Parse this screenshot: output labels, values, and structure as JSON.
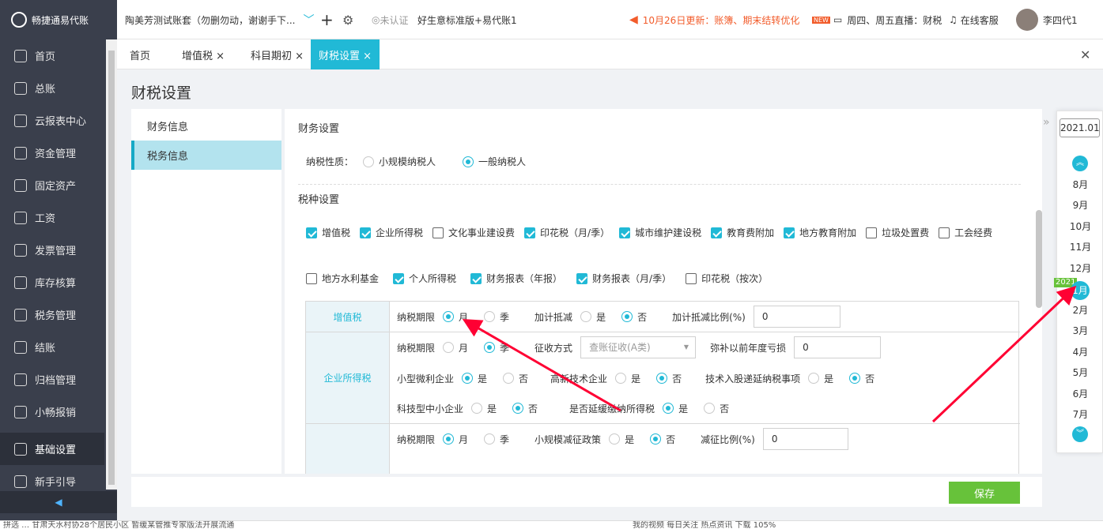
{
  "topbar": {
    "logo": "畅捷通易代账",
    "account": "陶美芳测试账套（勿删勿动，谢谢手下...",
    "plus": "+",
    "cert": "未认证",
    "product": "好生意标准版+易代账1",
    "notice": "10月26日更新：账簿、期末结转优化",
    "live_badge": "NEW",
    "live": "周四、周五直播：财税",
    "service": "在线客服",
    "user": "李四代1"
  },
  "sidebar": {
    "items": [
      {
        "label": "首页",
        "icon": "home-icon"
      },
      {
        "label": "总账",
        "icon": "ledger-icon"
      },
      {
        "label": "云报表中心",
        "icon": "chart-icon"
      },
      {
        "label": "资金管理",
        "icon": "money-icon"
      },
      {
        "label": "固定资产",
        "icon": "asset-icon"
      },
      {
        "label": "工资",
        "icon": "salary-icon"
      },
      {
        "label": "发票管理",
        "icon": "invoice-icon"
      },
      {
        "label": "库存核算",
        "icon": "warehouse-icon"
      },
      {
        "label": "税务管理",
        "icon": "tax-icon"
      },
      {
        "label": "结账",
        "icon": "close-book-icon"
      },
      {
        "label": "归档管理",
        "icon": "archive-icon"
      },
      {
        "label": "小畅报销",
        "icon": "reimburse-icon"
      },
      {
        "label": "基础设置",
        "icon": "settings-icon"
      },
      {
        "label": "新手引导",
        "icon": "guide-icon"
      }
    ]
  },
  "tabs": [
    {
      "label": "首页"
    },
    {
      "label": "增值税 ×"
    },
    {
      "label": "科目期初 ×"
    },
    {
      "label": "财税设置 ×"
    }
  ],
  "page": {
    "title": "财税设置",
    "left_nav": [
      "财务信息",
      "税务信息"
    ]
  },
  "panel": {
    "section1": "财务设置",
    "nature_label": "纳税性质：",
    "nature_options": [
      {
        "label": "小规模纳税人",
        "selected": false
      },
      {
        "label": "一般纳税人",
        "selected": true
      }
    ],
    "section2": "税种设置",
    "taxes_row1": [
      {
        "label": "增值税",
        "checked": true
      },
      {
        "label": "企业所得税",
        "checked": true
      },
      {
        "label": "文化事业建设费",
        "checked": false
      },
      {
        "label": "印花税（月/季）",
        "checked": true
      },
      {
        "label": "城市维护建设税",
        "checked": true
      },
      {
        "label": "教育费附加",
        "checked": true
      },
      {
        "label": "地方教育附加",
        "checked": true
      },
      {
        "label": "垃圾处置费",
        "checked": false
      },
      {
        "label": "工会经费",
        "checked": false
      }
    ],
    "taxes_row2": [
      {
        "label": "地方水利基金",
        "checked": false
      },
      {
        "label": "个人所得税",
        "checked": true
      },
      {
        "label": "财务报表（年报）",
        "checked": true
      },
      {
        "label": "财务报表（月/季）",
        "checked": true
      },
      {
        "label": "印花税（按次）",
        "checked": false
      }
    ],
    "vat": {
      "name": "增值税",
      "period_label": "纳税期限",
      "opt_month": "月",
      "opt_quarter": "季",
      "deduct_label": "加计抵减",
      "yes": "是",
      "no": "否",
      "ratio_label": "加计抵减比例(%)",
      "ratio_value": "0"
    },
    "cit": {
      "name": "企业所得税",
      "period_label": "纳税期限",
      "opt_month": "月",
      "opt_quarter": "季",
      "collect_label": "征收方式",
      "collect_value": "查账征收(A类)",
      "loss_label": "弥补以前年度亏损",
      "loss_value": "0",
      "small_label": "小型微利企业",
      "hitech_label": "高新技术企业",
      "tech_label": "技术入股递延纳税事项",
      "tsme_label": "科技型中小企业",
      "defer_label": "是否延缓缴纳所得税",
      "yes": "是",
      "no": "否"
    },
    "row3": {
      "period_label": "纳税期限",
      "opt_month": "月",
      "opt_quarter": "季",
      "reduce_label": "小规模减征政策",
      "yes": "是",
      "no": "否",
      "rate_label": "减征比例(%)",
      "rate_value": "0"
    }
  },
  "dock": {
    "year": "2021.01",
    "months_top": [
      "8月",
      "9月",
      "10月",
      "11月",
      "12月"
    ],
    "year_badge": "2021",
    "current": "1月",
    "months_bottom": [
      "2月",
      "3月",
      "4月",
      "5月",
      "6月",
      "7月"
    ]
  },
  "footer": {
    "save": "保存"
  },
  "status": {
    "left": "拼选 … 甘肃天水村协28个居民小区 暂缓某管推专家版法开展流通",
    "right": "我的视频  每日关注  热点资讯  下载  105%"
  }
}
